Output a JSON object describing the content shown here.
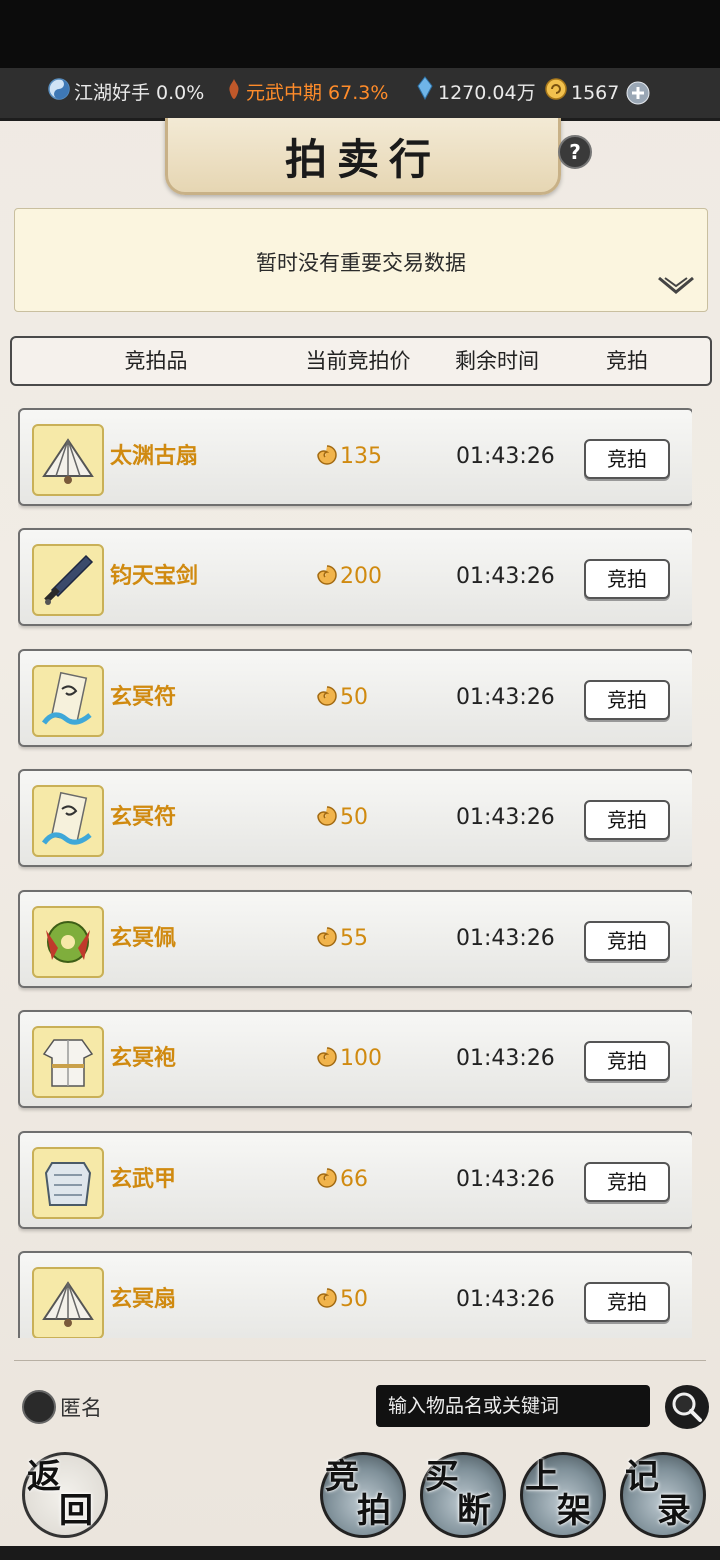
{
  "status": {
    "rank_label": "江湖好手 0.0%",
    "realm_label": "元武中期 67.3%",
    "currency1": "1270.04万",
    "currency2": "1567"
  },
  "title": "拍卖行",
  "notice": "暂时没有重要交易数据",
  "headers": {
    "item": "竞拍品",
    "price": "当前竞拍价",
    "time": "剩余时间",
    "bid": "竞拍"
  },
  "items": [
    {
      "name": "太渊古扇",
      "price": "135",
      "time": "01:43:26",
      "bid": "竞拍",
      "icon": "fan-icon"
    },
    {
      "name": "钧天宝剑",
      "price": "200",
      "time": "01:43:26",
      "bid": "竞拍",
      "icon": "sword-icon"
    },
    {
      "name": "玄冥符",
      "price": "50",
      "time": "01:43:26",
      "bid": "竞拍",
      "icon": "talisman-icon"
    },
    {
      "name": "玄冥符",
      "price": "50",
      "time": "01:43:26",
      "bid": "竞拍",
      "icon": "talisman-icon"
    },
    {
      "name": "玄冥佩",
      "price": "55",
      "time": "01:43:26",
      "bid": "竞拍",
      "icon": "pendant-icon"
    },
    {
      "name": "玄冥袍",
      "price": "100",
      "time": "01:43:26",
      "bid": "竞拍",
      "icon": "robe-icon"
    },
    {
      "name": "玄武甲",
      "price": "66",
      "time": "01:43:26",
      "bid": "竞拍",
      "icon": "armor-icon"
    },
    {
      "name": "玄冥扇",
      "price": "50",
      "time": "01:43:26",
      "bid": "竞拍",
      "icon": "fan-icon"
    }
  ],
  "anon_label": "匿名",
  "search_placeholder": "输入物品名或关键词",
  "nav": {
    "back": [
      "返",
      "回"
    ],
    "bid": [
      "竞",
      "拍"
    ],
    "buyout": [
      "买",
      "断"
    ],
    "list": [
      "上",
      "架"
    ],
    "record": [
      "记",
      "录"
    ]
  },
  "colors": {
    "item_name": "#d08a10",
    "price": "#d08a10",
    "realm": "#ff8c2a"
  }
}
